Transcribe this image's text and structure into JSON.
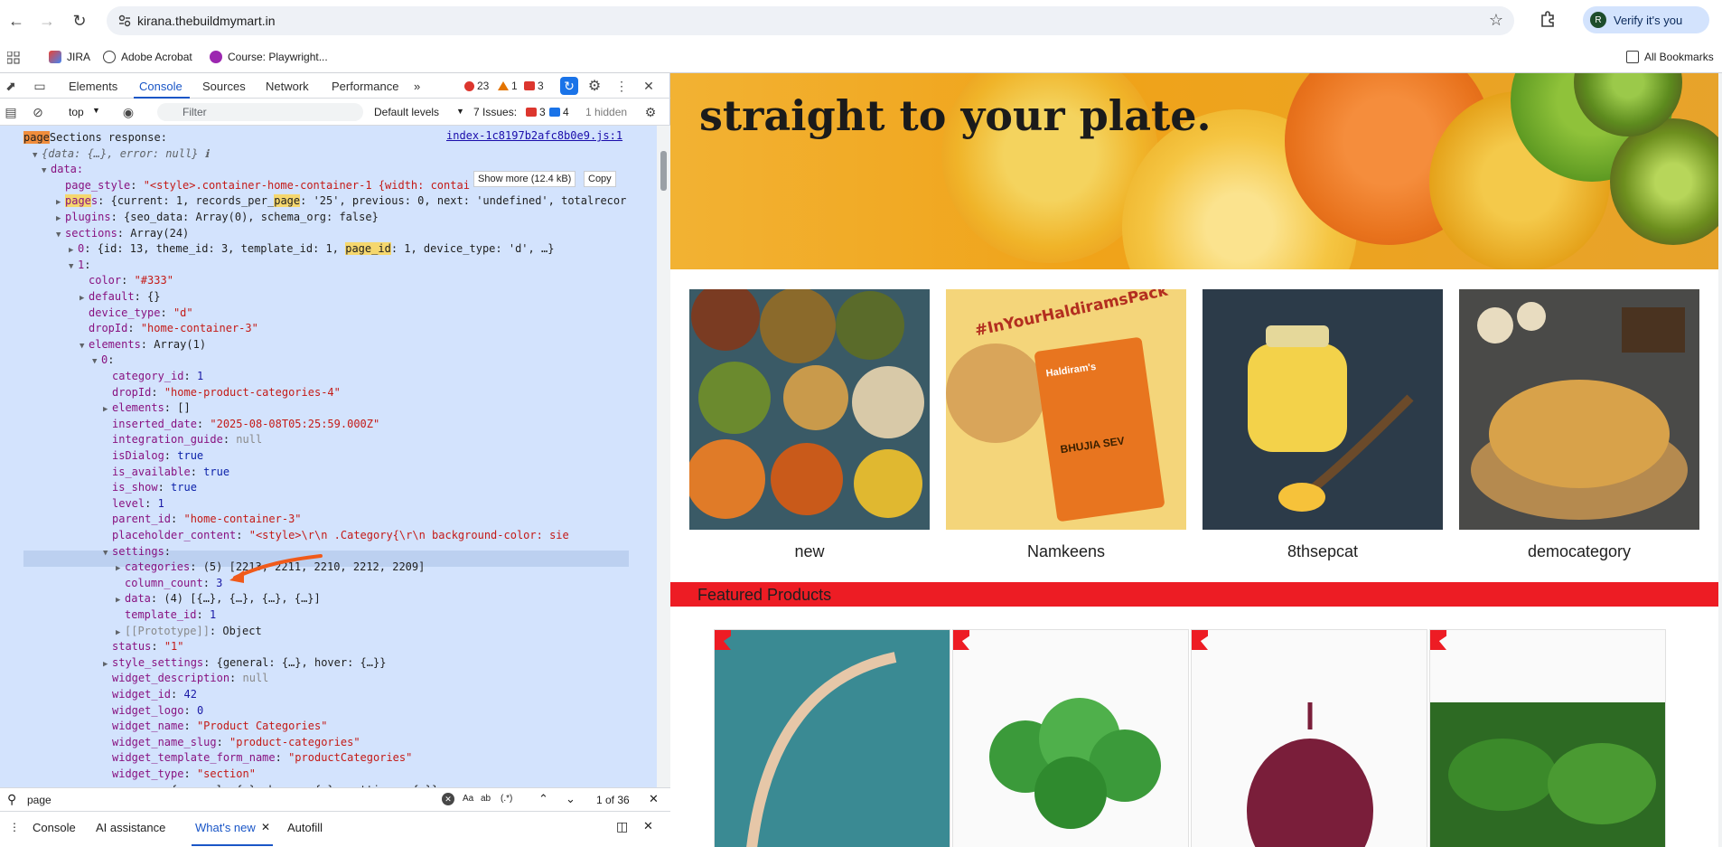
{
  "browser": {
    "url": "kirana.thebuildmymart.in",
    "verify_label": "Verify it's you",
    "avatar_letter": "R",
    "bookmarks": [
      "JIRA",
      "Adobe Acrobat",
      "Course: Playwright...",
      "All Bookmarks"
    ]
  },
  "devtools": {
    "tabs": [
      "Elements",
      "Console",
      "Sources",
      "Network",
      "Performance"
    ],
    "more_tabs": "»",
    "errors": "23",
    "warnings": "1",
    "messages": "3",
    "context": "top",
    "filter_placeholder": "Filter",
    "levels": "Default levels",
    "issues_label": "7 Issues:",
    "issues_errors": "3",
    "issues_info": "4",
    "hidden": "1 hidden",
    "file_link": "index-1c8197b2afc8b0e9.js:1",
    "show_more": "Show more (12.4 kB)",
    "copy": "Copy",
    "find_query": "page",
    "find_count": "1 of 36",
    "drawer_tabs": [
      "Console",
      "AI assistance",
      "What's new",
      "Autofill"
    ],
    "console_lines": [
      {
        "t": "l0",
        "text_pre": "",
        "hl": "page",
        "text": "Sections response:"
      },
      {
        "t": "l1",
        "text": "{data: {…}, error: null} ℹ"
      },
      {
        "t": "l2",
        "text": "data:"
      },
      {
        "t": "l3",
        "key": "page_style",
        "val": "\"<style>.container-home-container-1 {width: contai"
      },
      {
        "t": "l4",
        "key": "pages",
        "val": "{current: 1, records_per_page: '25', previous: 0, next: 'undefined', totalrecor"
      },
      {
        "t": "l5",
        "key": "plugins",
        "val": "{seo_data: Array(0), schema_org: false}"
      },
      {
        "t": "l6",
        "key": "sections",
        "val": "Array(24)"
      },
      {
        "t": "l7",
        "key": "0",
        "val": "{id: 13, theme_id: 3, template_id: 1, page_id: 1, device_type: 'd', …}"
      },
      {
        "t": "l8",
        "key": "1",
        "val": ""
      },
      {
        "t": "l9",
        "key": "color",
        "val": "\"#333\""
      },
      {
        "t": "l10",
        "key": "default",
        "val": "{}"
      },
      {
        "t": "l11",
        "key": "device_type",
        "val": "\"d\""
      },
      {
        "t": "l12",
        "key": "dropId",
        "val": "\"home-container-3\""
      },
      {
        "t": "l13",
        "key": "elements",
        "val": "Array(1)"
      },
      {
        "t": "l14",
        "key": "0",
        "val": ""
      },
      {
        "t": "l15",
        "key": "category_id",
        "val": "1"
      },
      {
        "t": "l16",
        "key": "dropId",
        "val": "\"home-product-categories-4\""
      },
      {
        "t": "l17",
        "key": "elements",
        "val": "[]"
      },
      {
        "t": "l18",
        "key": "inserted_date",
        "val": "\"2025-08-08T05:25:59.000Z\""
      },
      {
        "t": "l19",
        "key": "integration_guide",
        "val": "null"
      },
      {
        "t": "l20",
        "key": "isDialog",
        "val": "true"
      },
      {
        "t": "l21",
        "key": "is_available",
        "val": "true"
      },
      {
        "t": "l22",
        "key": "is_show",
        "val": "true"
      },
      {
        "t": "l23",
        "key": "level",
        "val": "1"
      },
      {
        "t": "l24",
        "key": "parent_id",
        "val": "\"home-container-3\""
      },
      {
        "t": "l25",
        "key": "placeholder_content",
        "val": "\"<style>\\r\\n .Category{\\r\\n         background-color: sie"
      },
      {
        "t": "l26",
        "key": "settings",
        "val": ""
      },
      {
        "t": "l27",
        "key": "categories",
        "val": "(5) [2213, 2211, 2210, 2212, 2209]"
      },
      {
        "t": "l28",
        "key": "column_count",
        "val": "3"
      },
      {
        "t": "l29",
        "key": "data",
        "val": "(4) [{…}, {…}, {…}, {…}]"
      },
      {
        "t": "l30",
        "key": "template_id",
        "val": "1"
      },
      {
        "t": "l31",
        "key": "[[Prototype]]",
        "val": "Object"
      },
      {
        "t": "l32",
        "key": "status",
        "val": "\"1\""
      },
      {
        "t": "l33",
        "key": "style_settings",
        "val": "{general: {…}, hover: {…}}"
      },
      {
        "t": "l34",
        "key": "widget_description",
        "val": "null"
      },
      {
        "t": "l35",
        "key": "widget_id",
        "val": "42"
      },
      {
        "t": "l36",
        "key": "widget_logo",
        "val": "0"
      },
      {
        "t": "l37",
        "key": "widget_name",
        "val": "\"Product Categories\""
      },
      {
        "t": "l38",
        "key": "widget_name_slug",
        "val": "\"product-categories\""
      },
      {
        "t": "l39",
        "key": "widget_template_form_name",
        "val": "\"productCategories\""
      },
      {
        "t": "l40",
        "key": "widget_type",
        "val": "\"section\""
      },
      {
        "t": "l41",
        "key": "wrapper",
        "val": "{general: {…}, hover: {…}, settings: {…}}"
      }
    ]
  },
  "page": {
    "hero_text": "straight to your plate.",
    "categories": [
      "new",
      "Namkeens",
      "8thsepcat",
      "democategory"
    ],
    "pack_text": "#InYourHaldiramsPack",
    "pack_brand": "Haldiram's",
    "pack_product": "BHUJIA SEV",
    "featured_title": "Featured Products"
  }
}
